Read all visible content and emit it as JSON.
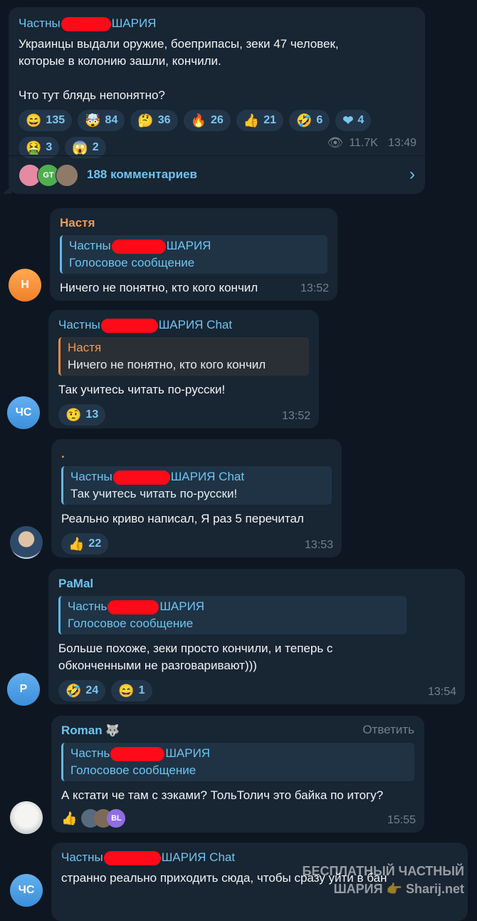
{
  "post": {
    "channel_left": "Частны",
    "channel_right": "ШАРИЯ",
    "text": "Украинцы выдали оружие, боеприпасы, зеки 47 человек,\nкоторые в колонию зашли, кончили.\n\nЧто тут блядь непонятно?",
    "reactions": [
      {
        "emoji": "😄",
        "count": "135"
      },
      {
        "emoji": "🤯",
        "count": "84"
      },
      {
        "emoji": "🤔",
        "count": "36"
      },
      {
        "emoji": "🔥",
        "count": "26"
      },
      {
        "emoji": "👍",
        "count": "21"
      },
      {
        "emoji": "🤣",
        "count": "6"
      },
      {
        "emoji": "❤",
        "count": "4"
      },
      {
        "emoji": "🤮",
        "count": "3"
      },
      {
        "emoji": "😱",
        "count": "2"
      }
    ],
    "views": "11.7K",
    "time": "13:49",
    "comments_label": "188 комментариев",
    "commenter_avatar_text": "GT"
  },
  "messages": [
    {
      "author": "Настя",
      "avatar": "Н",
      "quote_author_left": "Частны",
      "quote_author_right": "ШАРИЯ",
      "quote_text": "Голосовое сообщение",
      "text": "Ничего не понятно, кто кого кончил",
      "time": "13:52"
    },
    {
      "author_left": "Частны",
      "author_right": "ШАРИЯ Chat",
      "avatar": "ЧС",
      "quote_author": "Настя",
      "quote_text": "Ничего не понятно, кто кого кончил",
      "text": "Так учитесь читать по-русски!",
      "reactions": [
        {
          "emoji": "🤨",
          "count": "13"
        }
      ],
      "time": "13:52"
    },
    {
      "author": ".",
      "quote_author_left": "Частны",
      "quote_author_right": "ШАРИЯ Chat",
      "quote_text": "Так учитесь читать по-русски!",
      "text": "Реально криво написал, Я раз 5 перечитал",
      "reactions": [
        {
          "emoji": "👍",
          "count": "22"
        }
      ],
      "time": "13:53"
    },
    {
      "author": "PaMal",
      "avatar": "P",
      "quote_author_left": "Частнь",
      "quote_author_right": "ШАРИЯ",
      "quote_text": "Голосовое сообщение",
      "text": "Больше похоже, зеки просто кончили, и теперь с\nобконченными не разговаривают)))",
      "reactions": [
        {
          "emoji": "🤣",
          "count": "24"
        },
        {
          "emoji": "😄",
          "count": "1"
        }
      ],
      "time": "13:54"
    },
    {
      "author": "Roman",
      "reply_label": "Ответить",
      "quote_author_left": "Частнь",
      "quote_author_right": "ШАРИЯ",
      "quote_text": "Голосовое сообщение",
      "text": "А кстати че там с зэками? ТольТолич это байка по итогу?",
      "reactions": [
        {
          "emoji": "👍",
          "count": ""
        }
      ],
      "reactor_avatar_text": "BL",
      "time": "15:55"
    },
    {
      "author_left": "Частны",
      "author_right": "ШАРИЯ Chat",
      "avatar": "ЧС",
      "text": "странно реально приходить сюда, чтобы сразу уйти в бан"
    }
  ],
  "watermark": {
    "line1": "БЕСПЛАТНЫЙ ЧАСТНЫЙ",
    "line2": "ШАРИЯ 👉 Sharij.net"
  }
}
